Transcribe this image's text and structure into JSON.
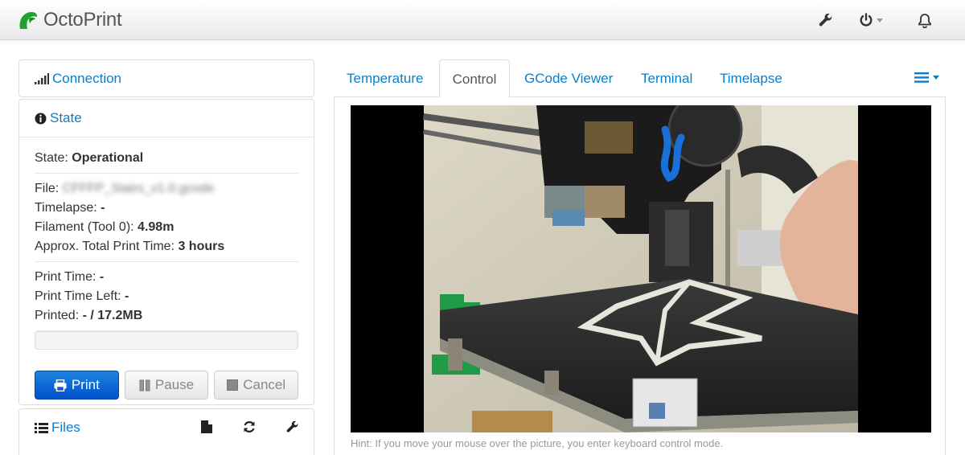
{
  "app": {
    "brand": "OctoPrint"
  },
  "sidebar": {
    "connection_label": "Connection",
    "state_label": "State",
    "state": {
      "state_key": "State:",
      "state_value": "Operational",
      "file_key": "File:",
      "file_value": "CFFFP_Stairs_v1.0.gcode",
      "timelapse_key": "Timelapse:",
      "timelapse_value": "-",
      "filament_key": "Filament (Tool 0):",
      "filament_value": "4.98m",
      "total_time_key": "Approx. Total Print Time:",
      "total_time_value": "3 hours",
      "print_time_key": "Print Time:",
      "print_time_value": "-",
      "time_left_key": "Print Time Left:",
      "time_left_value": "-",
      "printed_key": "Printed:",
      "printed_value": "- / 17.2MB",
      "progress": 0
    },
    "buttons": {
      "print": "Print",
      "pause": "Pause",
      "cancel": "Cancel"
    },
    "files_label": "Files"
  },
  "tabs": [
    {
      "label": "Temperature"
    },
    {
      "label": "Control",
      "active": true
    },
    {
      "label": "GCode Viewer"
    },
    {
      "label": "Terminal"
    },
    {
      "label": "Timelapse"
    }
  ],
  "control": {
    "hint": "Hint: If you move your mouse over the picture, you enter keyboard control mode."
  },
  "colors": {
    "link": "#0a7ec9",
    "primary": "#0062cc",
    "logo": "#1fa32e"
  }
}
